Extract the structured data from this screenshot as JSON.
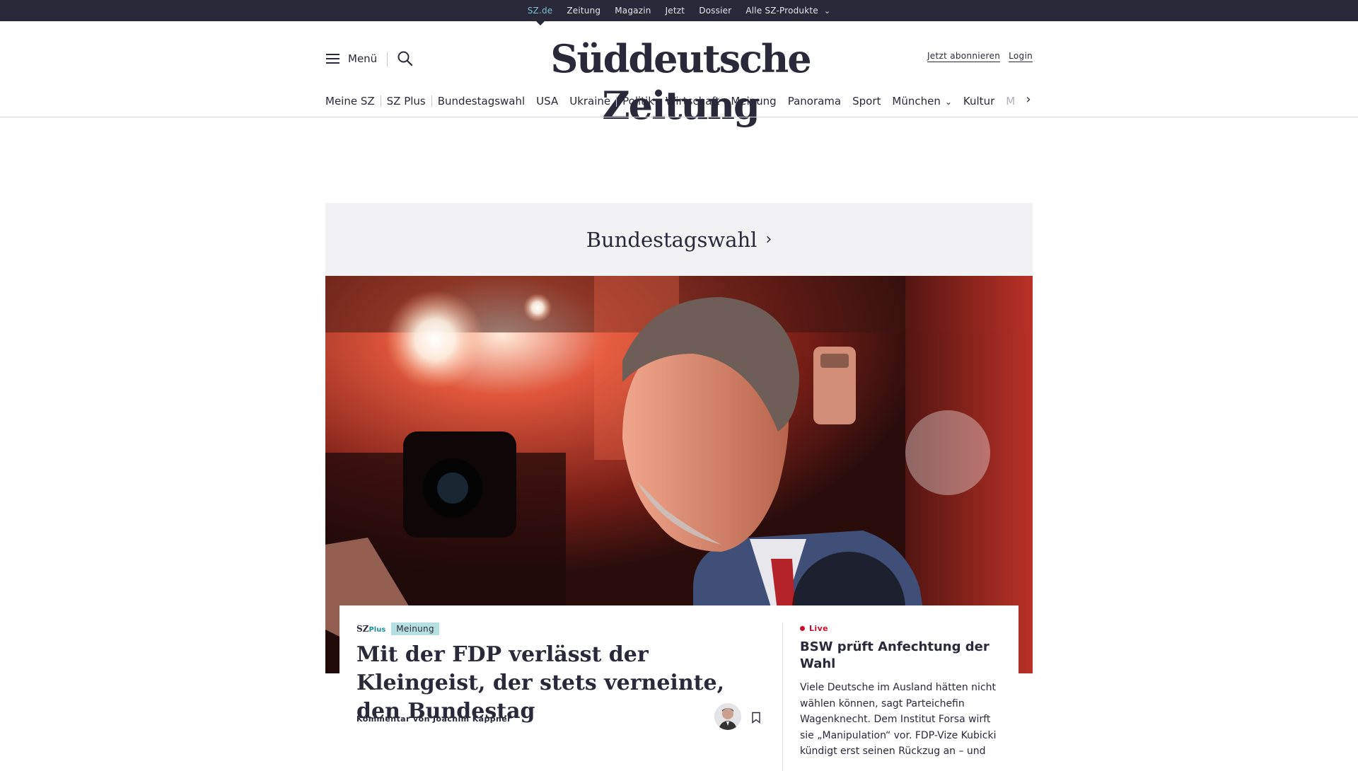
{
  "topbar": {
    "links": [
      {
        "label": "SZ.de",
        "active": true
      },
      {
        "label": "Zeitung"
      },
      {
        "label": "Magazin"
      },
      {
        "label": "Jetzt"
      },
      {
        "label": "Dossier"
      },
      {
        "label": "Alle SZ-Produkte",
        "has_dropdown": true
      }
    ]
  },
  "header": {
    "menu_label": "Menü",
    "logo": "Süddeutsche Zeitung",
    "subscribe_label": "Jetzt abonnieren",
    "login_label": "Login",
    "icons": {
      "menu": "hamburger-icon",
      "search": "search-icon"
    }
  },
  "sectionnav": {
    "items": [
      "Meine SZ",
      "SZ Plus",
      "Bundestagswahl",
      "USA",
      "Ukraine",
      "Politik",
      "Wirtschaft",
      "Meinung",
      "Panorama",
      "Sport",
      "München",
      "Kultur",
      "M"
    ],
    "next_icon": "chevron-right-icon"
  },
  "hero": {
    "section_title": "Bundestagswahl",
    "section_arrow": "›",
    "main": {
      "brand": "SZ",
      "brand_suffix": "Plus",
      "tag": "Meinung",
      "headline": "Mit der FDP verlässt der Kleingeist, der stets verneinte, den Bundestag",
      "author": "Kommentar von Joachim Käppner"
    },
    "side": {
      "live_label": "Live",
      "title": "BSW prüft Anfechtung der Wahl",
      "text": "Viele Deutsche im Ausland hätten nicht wählen können, sagt Parteichefin Wagenknecht. Dem Institut Forsa wirft sie „Manipulation“ vor. FDP-Vize Kubicki kündigt erst seinen Rückzug an – und"
    }
  },
  "colors": {
    "topbar_bg": "#29293a",
    "text": "#29293a",
    "accent_teal": "#b6dfe0",
    "live_red": "#c8102e",
    "section_bg": "#f2f2f4"
  }
}
